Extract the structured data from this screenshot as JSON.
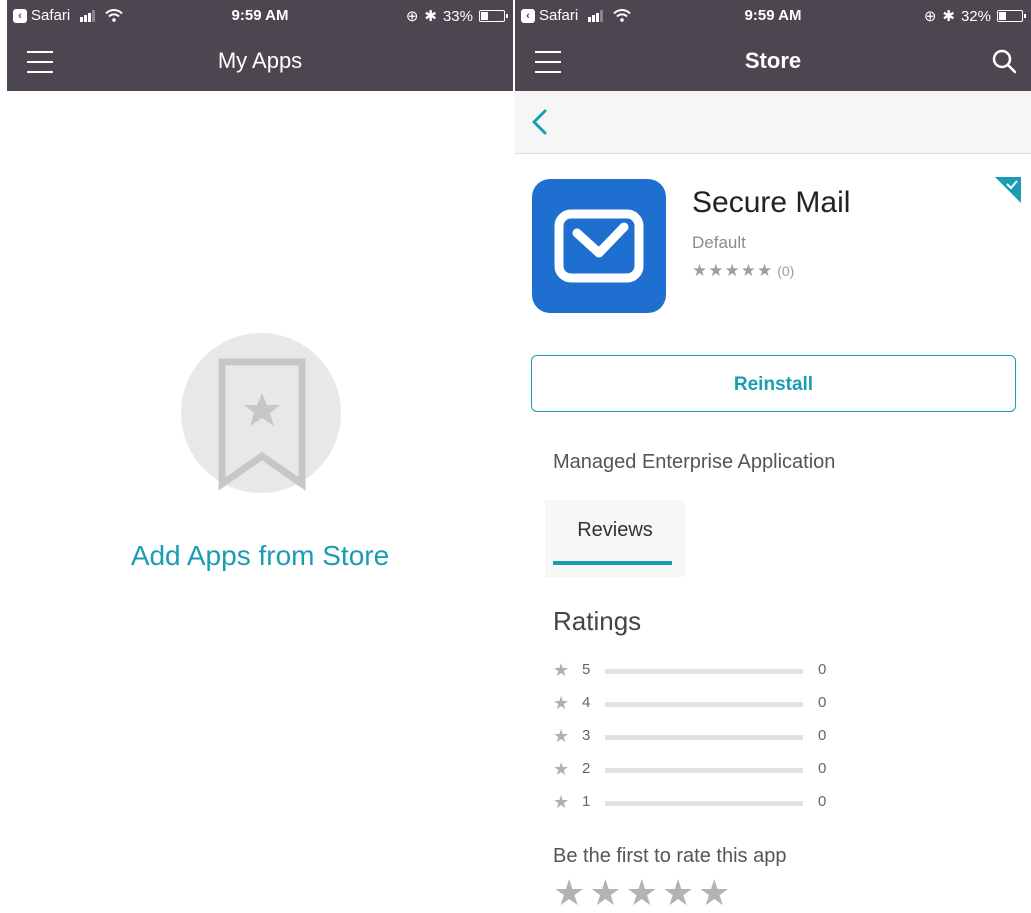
{
  "left_screen": {
    "status": {
      "back_app": "Safari",
      "time": "9:59 AM",
      "battery": "33%",
      "battery_level": 0.33
    },
    "nav": {
      "title": "My Apps"
    },
    "empty_state": {
      "link": "Add Apps from Store",
      "icon": "bookmark-star-icon"
    }
  },
  "right_screen": {
    "status": {
      "back_app": "Safari",
      "time": "9:59 AM",
      "battery": "32%",
      "battery_level": 0.32
    },
    "nav": {
      "title": "Store"
    },
    "app": {
      "name": "Secure Mail",
      "category": "Default",
      "stars": "★★★★★",
      "rating_count": "(0)",
      "icon_color": "#1e6fd0"
    },
    "reinstall_label": "Reinstall",
    "app_type": "Managed Enterprise Application",
    "tabs": [
      {
        "label": "Reviews"
      }
    ],
    "ratings": {
      "title": "Ratings",
      "rows": [
        {
          "stars": "5",
          "count": "0",
          "fraction": 0
        },
        {
          "stars": "4",
          "count": "0",
          "fraction": 0
        },
        {
          "stars": "3",
          "count": "0",
          "fraction": 0
        },
        {
          "stars": "2",
          "count": "0",
          "fraction": 0
        },
        {
          "stars": "1",
          "count": "0",
          "fraction": 0
        }
      ],
      "prompt": "Be the first to rate this app",
      "rate_stars": [
        "★",
        "★",
        "★",
        "★",
        "★"
      ]
    }
  },
  "colors": {
    "header": "#4d4650",
    "accent": "#1a9db3",
    "app_icon": "#1e6fd0"
  }
}
